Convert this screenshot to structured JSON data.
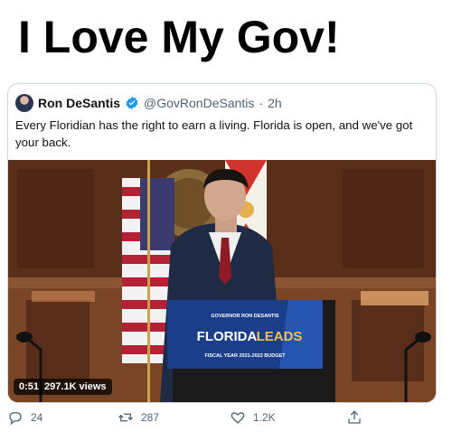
{
  "headline": "I Love My Gov!",
  "tweet": {
    "author_name": "Ron DeSantis",
    "handle": "@GovRonDeSantis",
    "separator": "·",
    "time": "2h",
    "text": "Every Floridian has the right to earn a living. Florida is open, and we've got your back.",
    "verified_color": "#1d9bf0"
  },
  "video": {
    "duration": "0:51",
    "views": "297.1K views",
    "podium_line1": "GOVERNOR RON DESANTIS",
    "podium_line2a": "FLORIDA",
    "podium_line2b": "LEADS",
    "podium_line3": "FISCAL YEAR 2021-2022 BUDGET"
  },
  "actions": {
    "reply_count": "24",
    "retweet_count": "287",
    "like_count": "1.2K"
  }
}
